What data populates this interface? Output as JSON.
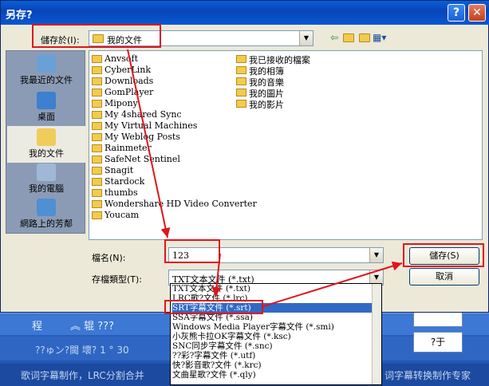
{
  "dialog": {
    "title": "另存?",
    "help_label": "?",
    "close_label": "✕"
  },
  "save_in": {
    "label": "儲存於(I):",
    "value": "我的文件"
  },
  "places": [
    {
      "label": "我最近的文件",
      "icon": "recent-docs-icon"
    },
    {
      "label": "桌面",
      "icon": "desktop-icon"
    },
    {
      "label": "我的文件",
      "icon": "my-documents-icon"
    },
    {
      "label": "我的電腦",
      "icon": "my-computer-icon"
    },
    {
      "label": "網路上的芳鄰",
      "icon": "network-icon"
    }
  ],
  "files_left": [
    "Anvsoft",
    "CyberLink",
    "Downloads",
    "GomPlayer",
    "Mipony",
    "My 4shared Sync",
    "My Virtual Machines",
    "My Weblog Posts",
    "Rainmeter",
    "SafeNet Sentinel",
    "Snagit",
    "Stardock",
    "thumbs",
    "Wondershare HD Video Converter",
    "Youcam"
  ],
  "files_right": [
    "我已接收的檔案",
    "我的相簿",
    "我的音樂",
    "我的圖片",
    "我的影片"
  ],
  "filename": {
    "label": "檔名(N):",
    "value": "123"
  },
  "filetype": {
    "label": "存檔類型(T):",
    "value": "TXT文本文件 (*.txt)",
    "options": [
      "TXT文本文件 (*.txt)",
      "LRC歌?文件 (*.lrc)",
      "SRT字幕文件 (*.srt)",
      "SSA字幕文件 (*.ssa)",
      "Windows Media Player字幕文件 (*.smi)",
      "小灰熊卡拉OK字幕文件 (*.ksc)",
      "SNC同步字幕文件 (*.snc)",
      "??彩?字幕文件 (*.utf)",
      "快?影音歌?文件 (*.krc)",
      "文曲星歌?文件 (*.qly)"
    ],
    "selected_index": 2
  },
  "buttons": {
    "save": "儲存(S)",
    "cancel": "取消"
  },
  "background_app": {
    "row1_left": "程",
    "row1_mid": "︽  辊  ???",
    "row2_text": "??ゅン?閫    壞?  1 ° 30",
    "row3_left": "歌词字幕制作，LRC分割合并",
    "row3_right": "词字幕转换制作专家",
    "btn1": "?于"
  }
}
